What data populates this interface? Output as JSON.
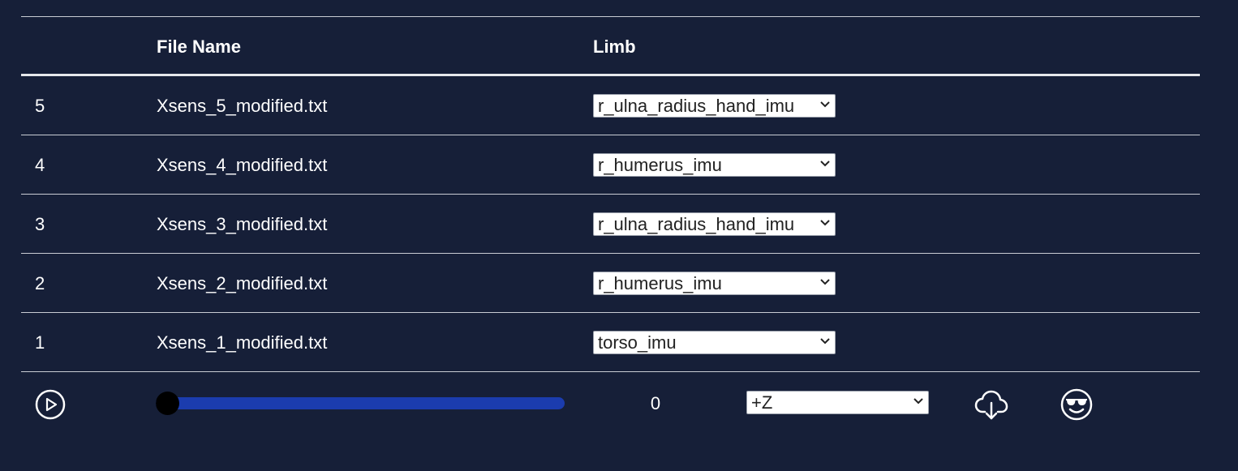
{
  "table": {
    "headers": {
      "number": "",
      "file_name": "File Name",
      "limb": "Limb"
    },
    "rows": [
      {
        "num": "5",
        "file": "Xsens_5_modified.txt",
        "limb": "r_ulna_radius_hand_imu"
      },
      {
        "num": "4",
        "file": "Xsens_4_modified.txt",
        "limb": "r_humerus_imu"
      },
      {
        "num": "3",
        "file": "Xsens_3_modified.txt",
        "limb": "r_ulna_radius_hand_imu"
      },
      {
        "num": "2",
        "file": "Xsens_2_modified.txt",
        "limb": "r_humerus_imu"
      },
      {
        "num": "1",
        "file": "Xsens_1_modified.txt",
        "limb": "torso_imu"
      }
    ]
  },
  "controls": {
    "play_icon": "play-circle-icon",
    "slider_value_fraction": 0.0,
    "frame_value": "0",
    "axis_selected": "+Z",
    "download_icon": "cloud-download-icon",
    "emoji_icon": "sunglasses-face-icon"
  },
  "colors": {
    "background": "#161f38",
    "slider_track": "#1b3cae",
    "slider_thumb": "#000000",
    "text": "#ffffff"
  }
}
